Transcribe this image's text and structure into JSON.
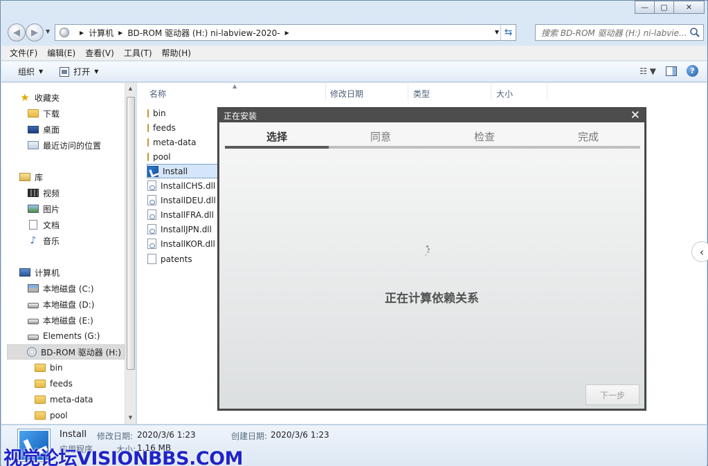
{
  "window": {
    "minimize_glyph": "—",
    "maximize_glyph": "▢",
    "close_glyph": "✕"
  },
  "address": {
    "crumbs": [
      "计算机",
      "BD-ROM 驱动器 (H:) ni-labview-2020-"
    ],
    "search_placeholder": "搜索 BD-ROM 驱动器 (H:) ni-labvie..."
  },
  "menu": [
    "文件(F)",
    "编辑(E)",
    "查看(V)",
    "工具(T)",
    "帮助(H)"
  ],
  "toolbar": {
    "organize": "组织",
    "open": "打开"
  },
  "navpane": {
    "items": [
      {
        "label": "收藏夹",
        "icon": "star-icon"
      },
      {
        "label": "下载",
        "icon": "downloads-folder-icon"
      },
      {
        "label": "桌面",
        "icon": "desktop-icon"
      },
      {
        "label": "最近访问的位置",
        "icon": "recent-places-icon"
      },
      {
        "label": "库",
        "icon": "library-icon"
      },
      {
        "label": "视频",
        "icon": "videos-icon"
      },
      {
        "label": "图片",
        "icon": "pictures-icon"
      },
      {
        "label": "文档",
        "icon": "documents-icon"
      },
      {
        "label": "音乐",
        "icon": "music-icon"
      },
      {
        "label": "计算机",
        "icon": "computer-icon"
      },
      {
        "label": "本地磁盘 (C:)",
        "icon": "system-drive-icon"
      },
      {
        "label": "本地磁盘 (D:)",
        "icon": "drive-icon"
      },
      {
        "label": "本地磁盘 (E:)",
        "icon": "drive-icon"
      },
      {
        "label": "Elements (G:)",
        "icon": "drive-icon"
      },
      {
        "label": "BD-ROM 驱动器 (H:)",
        "icon": "disc-icon"
      },
      {
        "label": "bin",
        "icon": "folder-icon"
      },
      {
        "label": "feeds",
        "icon": "folder-icon"
      },
      {
        "label": "meta-data",
        "icon": "folder-icon"
      },
      {
        "label": "pool",
        "icon": "folder-icon"
      }
    ]
  },
  "columns": [
    "名称",
    "修改日期",
    "类型",
    "大小"
  ],
  "files": [
    {
      "name": "bin",
      "icon": "folder-icon"
    },
    {
      "name": "feeds",
      "icon": "folder-icon"
    },
    {
      "name": "meta-data",
      "icon": "folder-icon"
    },
    {
      "name": "pool",
      "icon": "folder-icon"
    },
    {
      "name": "Install",
      "icon": "installer-icon"
    },
    {
      "name": "InstallCHS.dll",
      "icon": "dll-file-icon"
    },
    {
      "name": "InstallDEU.dll",
      "icon": "dll-file-icon"
    },
    {
      "name": "InstallFRA.dll",
      "icon": "dll-file-icon"
    },
    {
      "name": "InstallJPN.dll",
      "icon": "dll-file-icon"
    },
    {
      "name": "InstallKOR.dll",
      "icon": "dll-file-icon"
    },
    {
      "name": "patents",
      "icon": "blank-file-icon"
    }
  ],
  "status": {
    "name": "Install",
    "modified_label": "修改日期:",
    "modified_value": "2020/3/6 1:23",
    "created_label": "创建日期:",
    "created_value": "2020/3/6 1:23",
    "type_value": "应用程序",
    "size_label": "大小:",
    "size_value": "1.16 MB"
  },
  "dialog": {
    "title": "正在安装",
    "close_glyph": "✕",
    "steps": [
      "选择",
      "同意",
      "检查",
      "完成"
    ],
    "active_step": 0,
    "progress_fraction": 0.25,
    "status_text": "正在计算依赖关系",
    "next_button": "下一步"
  },
  "watermark": "视觉论坛VISIONBBS.COM",
  "colors": {
    "dialog_frame": "#4d4d4d",
    "selection": "#d5e6fa",
    "watermark": "#1f24c8"
  }
}
